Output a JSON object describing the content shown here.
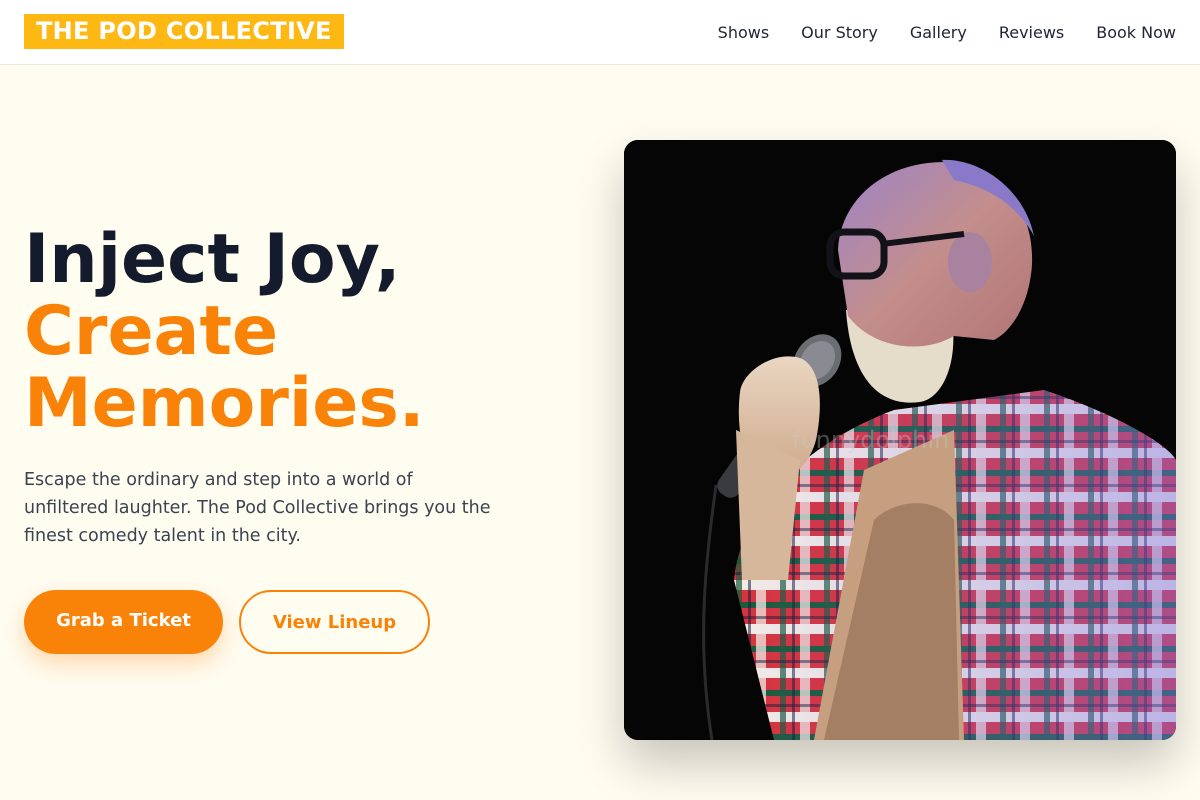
{
  "brand": {
    "logo_text": "THE POD COLLECTIVE",
    "color": "#fdb813"
  },
  "nav": {
    "items": [
      {
        "label": "Shows"
      },
      {
        "label": "Our Story"
      },
      {
        "label": "Gallery"
      },
      {
        "label": "Reviews"
      },
      {
        "label": "Book Now"
      }
    ]
  },
  "hero": {
    "headline_line1": "Inject Joy,",
    "headline_line2": "Create",
    "headline_line3": "Memories.",
    "description": "Escape the ordinary and step into a world of unfiltered laughter. The Pod Collective brings you the finest comedy talent in the city.",
    "primary_cta": "Grab a Ticket",
    "secondary_cta": "View Lineup",
    "image_watermark": "funnydolphin",
    "accent_color": "#f98209",
    "dark_color": "#141b2d"
  }
}
